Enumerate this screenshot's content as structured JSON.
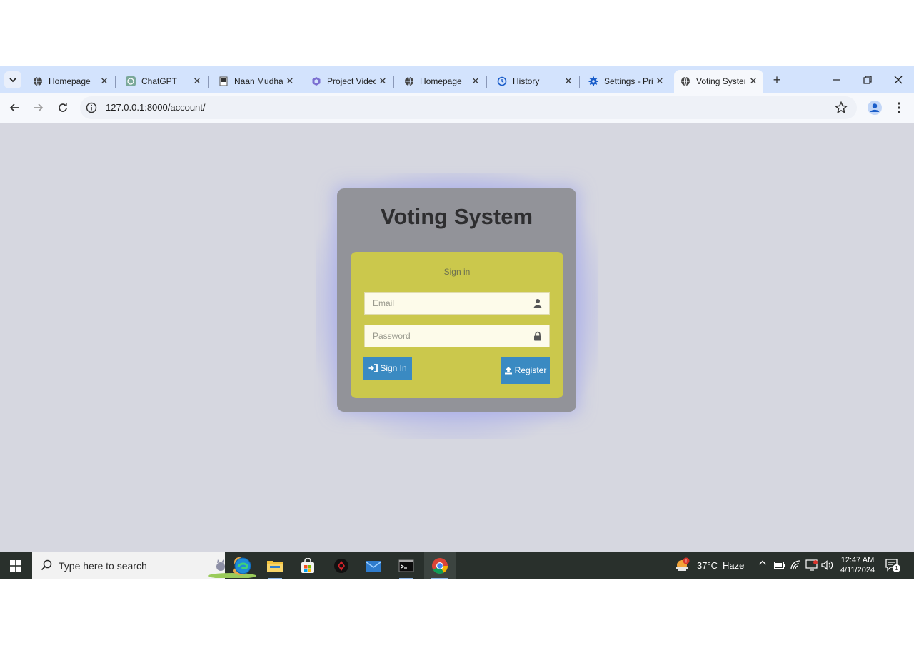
{
  "browser": {
    "tabs": [
      {
        "title": "Homepage",
        "icon": "globe-icon"
      },
      {
        "title": "ChatGPT",
        "icon": "chatgpt-icon"
      },
      {
        "title": "Naan Mudhalvan",
        "icon": "naan-mudhalvan-icon"
      },
      {
        "title": "Project Video",
        "icon": "hexagon-icon"
      },
      {
        "title": "Homepage",
        "icon": "globe-icon"
      },
      {
        "title": "History",
        "icon": "history-icon"
      },
      {
        "title": "Settings - Privacy",
        "icon": "settings-gear-icon"
      },
      {
        "title": "Voting System",
        "icon": "globe-icon",
        "active": true
      }
    ],
    "address_bar": {
      "url": "127.0.0.1:8000/account/"
    }
  },
  "page": {
    "title": "Voting System",
    "form": {
      "heading": "Sign in",
      "email_placeholder": "Email",
      "password_placeholder": "Password",
      "signin_label": "Sign In",
      "register_label": "Register"
    },
    "colors": {
      "background": "#d6d7e0",
      "card": "#929399",
      "panel": "#cbc84c",
      "button": "#3a8ac2"
    }
  },
  "taskbar": {
    "search_placeholder": "Type here to search",
    "weather": {
      "temp": "37°C",
      "condition": "Haze"
    },
    "clock": {
      "time": "12:47 AM",
      "date": "4/11/2024"
    },
    "notification_count": "1"
  }
}
